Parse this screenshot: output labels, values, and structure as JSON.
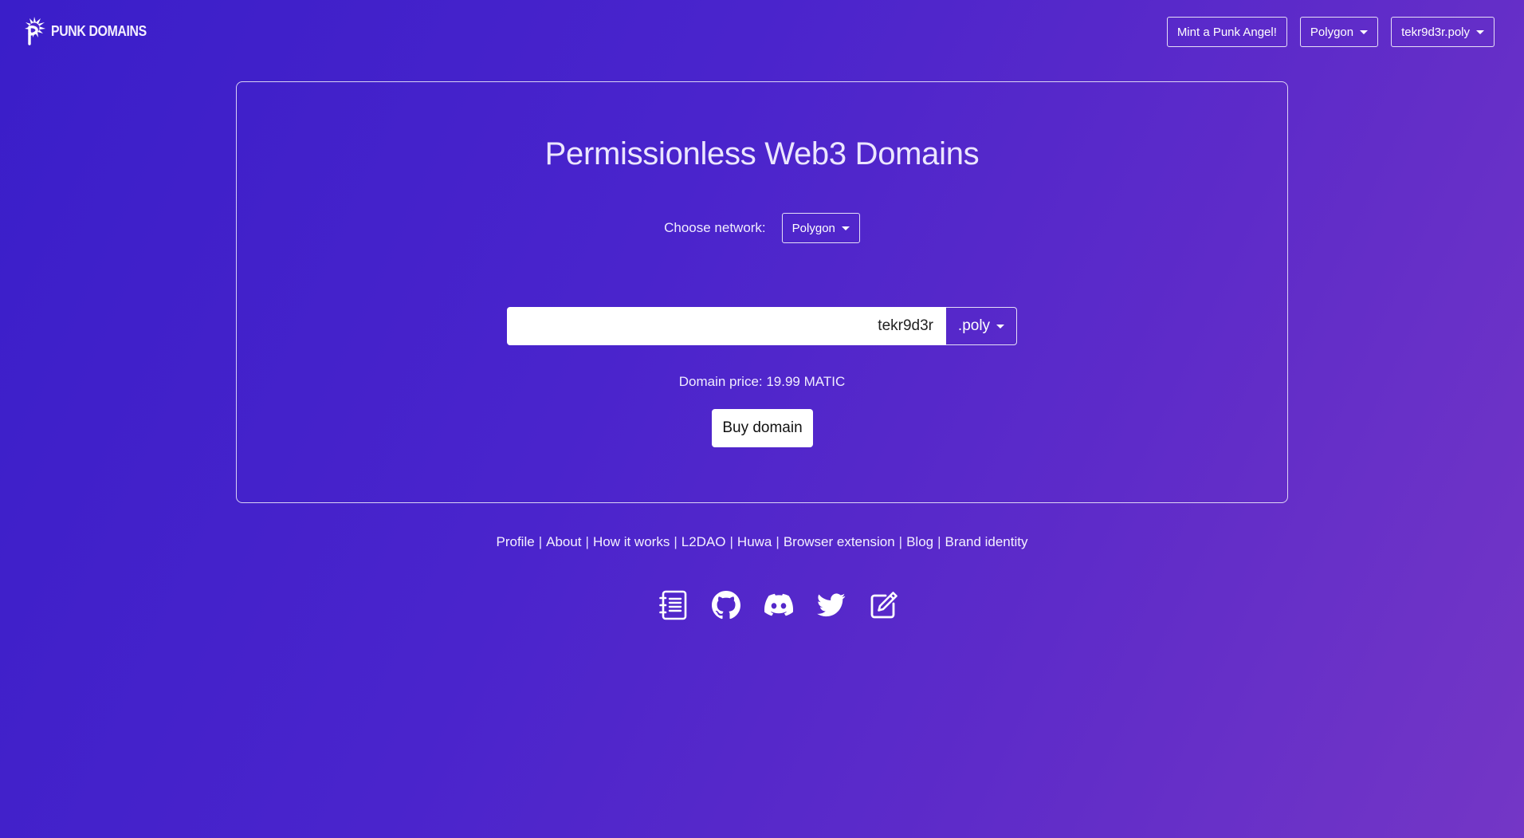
{
  "brand": {
    "name": "PUNK DOMAINS"
  },
  "navbar": {
    "mint_label": "Mint a Punk Angel!",
    "network_label": "Polygon",
    "account_label": "tekr9d3r.poly"
  },
  "main": {
    "title": "Permissionless Web3 Domains",
    "network_prompt": "Choose network:",
    "network_selected": "Polygon",
    "domain_input_value": "tekr9d3r",
    "tld_selected": ".poly",
    "price_text": "Domain price: 19.99 MATIC",
    "buy_label": "Buy domain"
  },
  "footer": {
    "links": [
      "Profile",
      "About",
      "How it works",
      "L2DAO",
      "Huwa",
      "Browser extension",
      "Blog",
      "Brand identity"
    ],
    "separator": "|",
    "social_icons": [
      "notebook-icon",
      "github-icon",
      "discord-icon",
      "twitter-icon",
      "edit-icon"
    ]
  },
  "colors": {
    "background_start": "#3a1ec9",
    "background_end": "#7436c6",
    "text": "#f0ecff",
    "button_light": "#ffffff"
  }
}
